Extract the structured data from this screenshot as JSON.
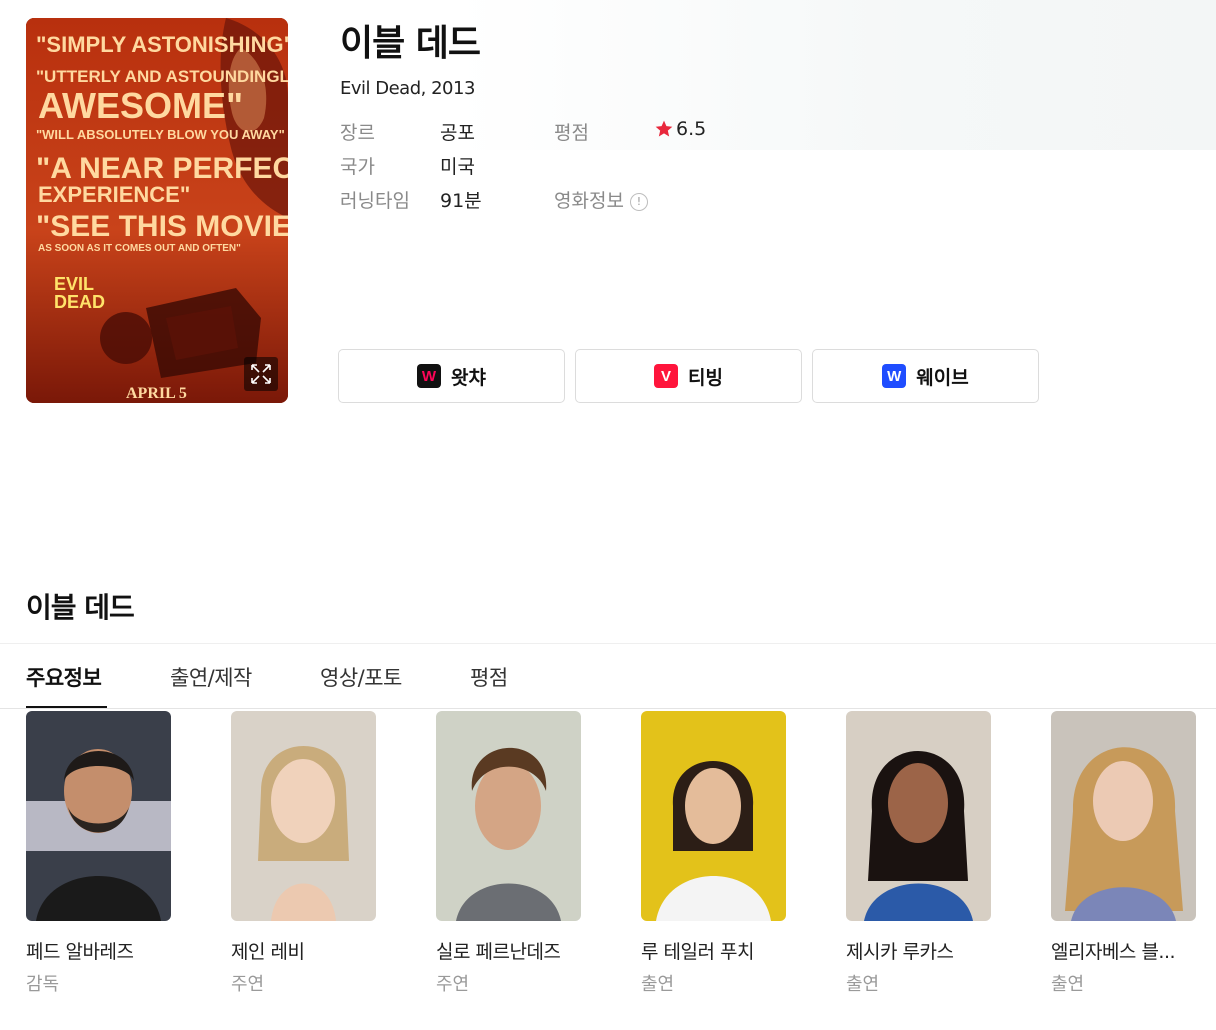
{
  "movie": {
    "title": "이블 데드",
    "subtitle": "Evil Dead, 2013",
    "poster": {
      "quote1": "\"SIMPLY ASTONISHING\"",
      "quote2": "\"UTTERLY AND ASTOUNDINGLY",
      "quote3": "AWESOME\"",
      "quote4": "\"WILL ABSOLUTELY BLOW YOU AWAY\"",
      "quote5": "\"A NEAR PERFECT",
      "quote6": "EXPERIENCE\"",
      "quote7": "\"SEE THIS MOVIE",
      "quote8": "AS SOON AS IT COMES OUT AND OFTEN\"",
      "logo_line1": "EVIL",
      "logo_line2": "DEAD",
      "date": "APRIL 5"
    }
  },
  "meta": {
    "genre_label": "장르",
    "genre_value": "공포",
    "rating_label": "평점",
    "rating_value": "6.5",
    "rating_star_color": "#e8283c",
    "country_label": "국가",
    "country_value": "미국",
    "runtime_label": "러닝타임",
    "runtime_value": "91분",
    "info_label": "영화정보",
    "info_icon_glyph": "!"
  },
  "ott": [
    {
      "label": "왓챠",
      "logo_glyph": "W",
      "color": "#ff0558",
      "bg": "#111111"
    },
    {
      "label": "티빙",
      "logo_glyph": "V",
      "color": "#ffffff",
      "bg": "#ff153c"
    },
    {
      "label": "웨이브",
      "logo_glyph": "W",
      "color": "#ffffff",
      "bg": "#1f4dff"
    }
  ],
  "section": {
    "title": "이블 데드",
    "tabs": [
      "주요정보",
      "출연/제작",
      "영상/포토",
      "평점"
    ],
    "active_tab": "주요정보"
  },
  "cast": [
    {
      "name": "페드 알바레즈",
      "role": "감독"
    },
    {
      "name": "제인 레비",
      "role": "주연"
    },
    {
      "name": "실로 페르난데즈",
      "role": "주연"
    },
    {
      "name": "루 테일러 푸치",
      "role": "출연"
    },
    {
      "name": "제시카 루카스",
      "role": "출연"
    },
    {
      "name": "엘리자베스 블...",
      "role": "출연"
    }
  ]
}
